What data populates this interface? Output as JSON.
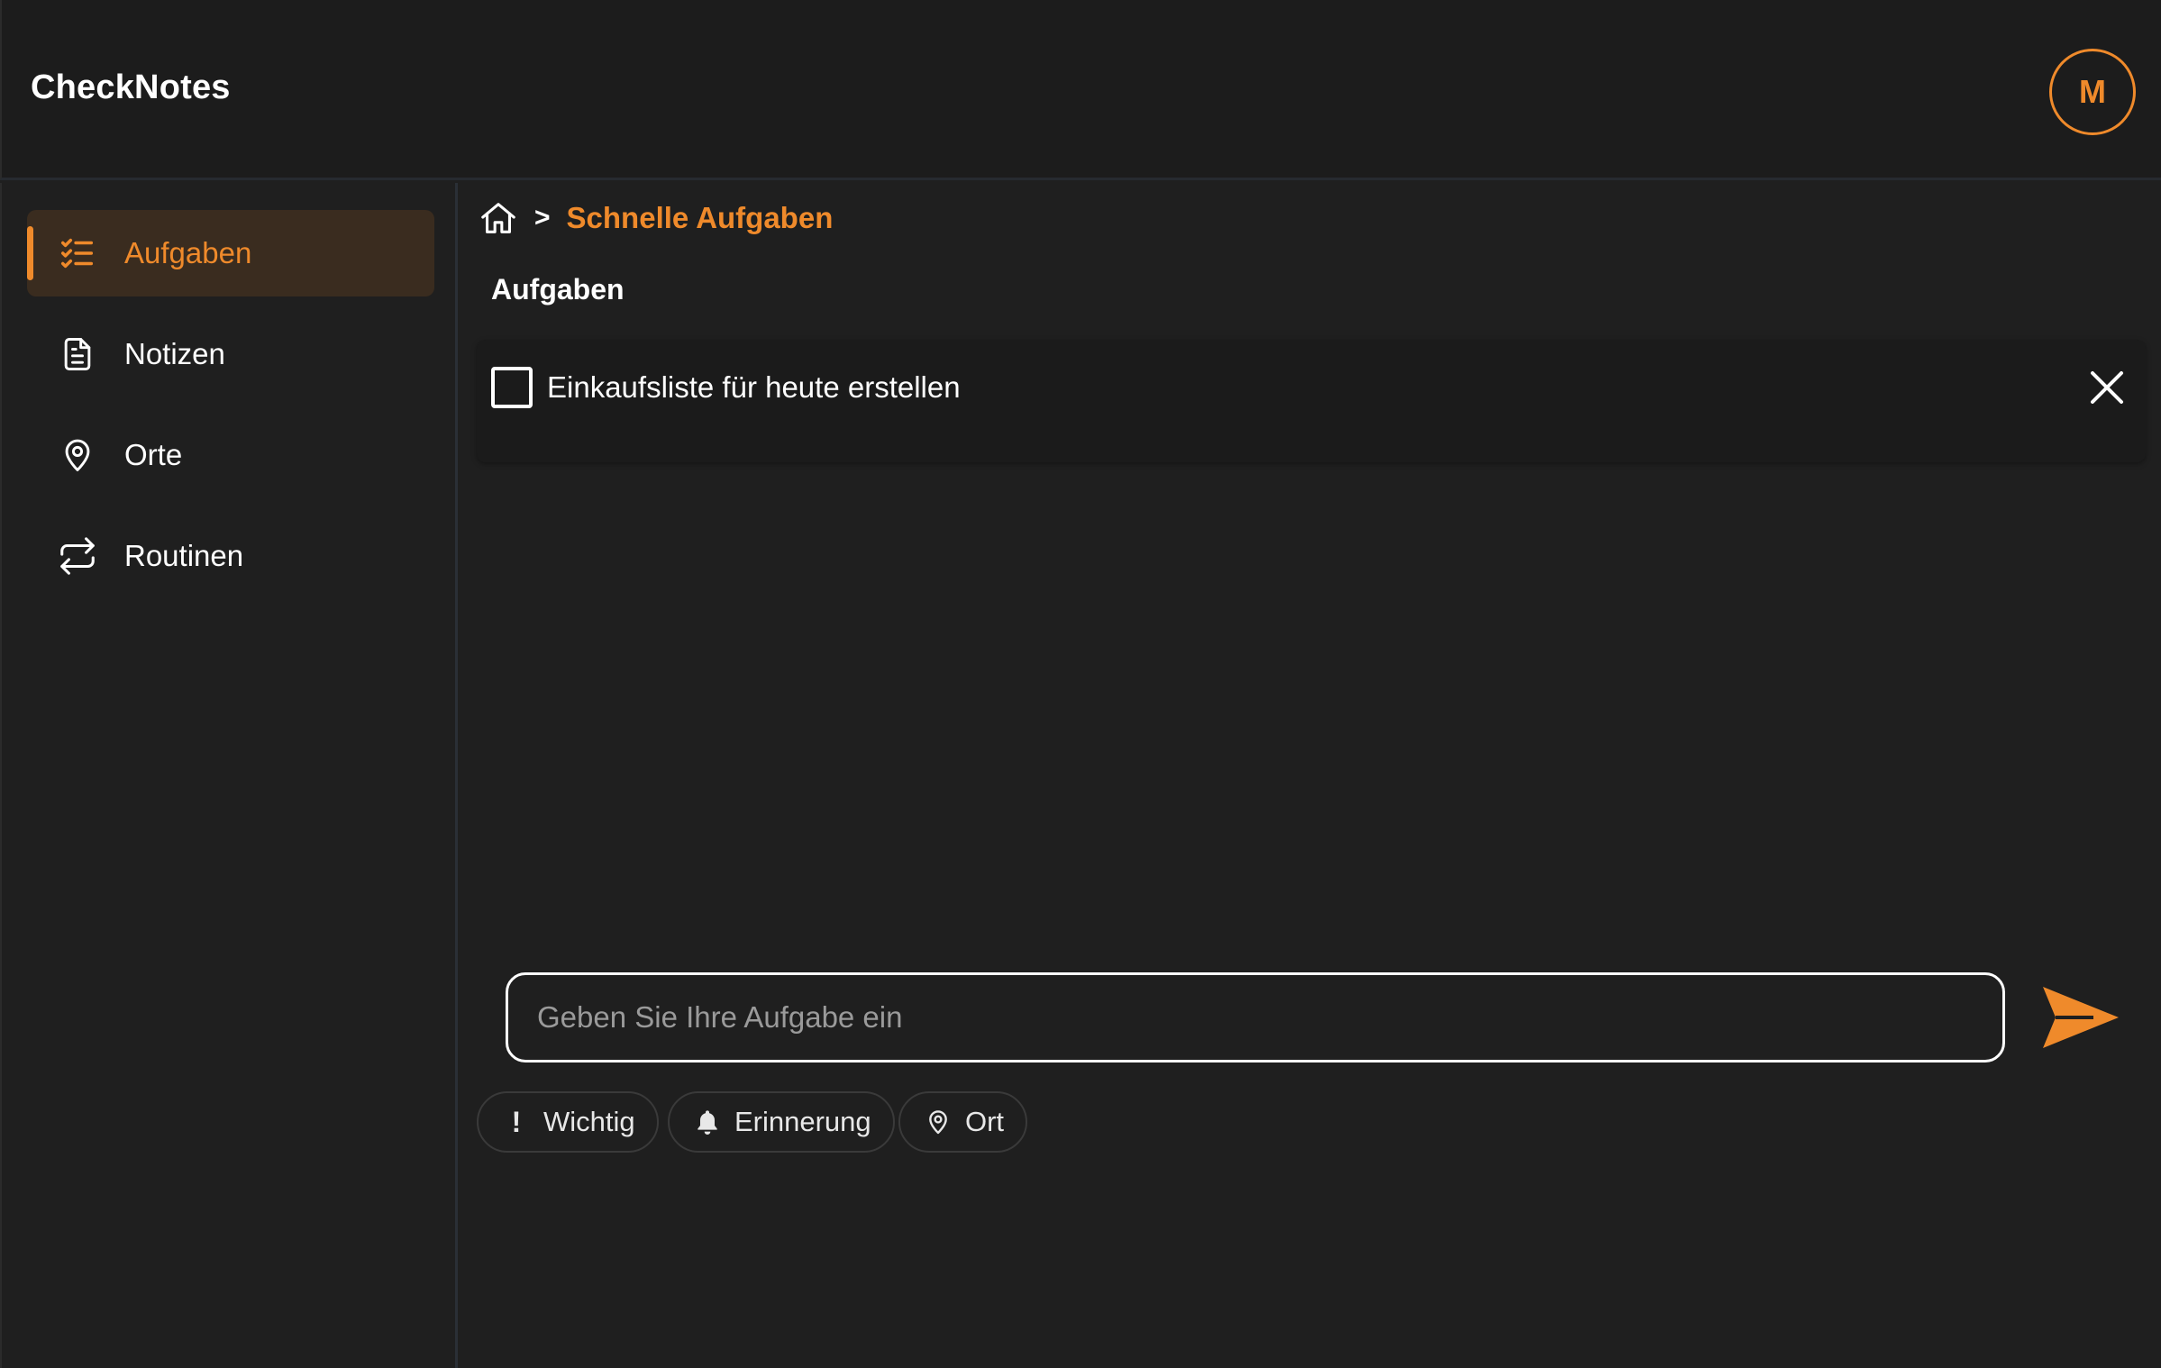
{
  "app": {
    "title": "CheckNotes",
    "avatar_initial": "M",
    "accent_color": "#ef8a2b"
  },
  "sidebar": {
    "items": [
      {
        "label": "Aufgaben",
        "icon": "checklist-icon",
        "active": true
      },
      {
        "label": "Notizen",
        "icon": "document-icon",
        "active": false
      },
      {
        "label": "Orte",
        "icon": "map-pin-icon",
        "active": false
      },
      {
        "label": "Routinen",
        "icon": "repeat-icon",
        "active": false
      }
    ]
  },
  "breadcrumb": {
    "separator": ">",
    "current": "Schnelle Aufgaben"
  },
  "main": {
    "section_title": "Aufgaben",
    "tasks": [
      {
        "text": "Einkaufsliste für heute erstellen",
        "checked": false
      }
    ]
  },
  "composer": {
    "placeholder": "Geben Sie Ihre Aufgabe ein",
    "chips": [
      {
        "label": "Wichtig",
        "icon": "exclamation-icon",
        "glyph": "!"
      },
      {
        "label": "Erinnerung",
        "icon": "bell-icon"
      },
      {
        "label": "Ort",
        "icon": "map-pin-icon"
      }
    ]
  }
}
